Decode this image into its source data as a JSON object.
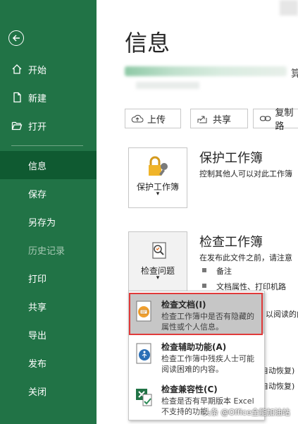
{
  "sidebar": {
    "items": [
      {
        "label": "开始"
      },
      {
        "label": "新建"
      },
      {
        "label": "打开"
      },
      {
        "label": "信息"
      },
      {
        "label": "保存"
      },
      {
        "label": "另存为"
      },
      {
        "label": "历史记录"
      },
      {
        "label": "打印"
      },
      {
        "label": "共享"
      },
      {
        "label": "导出"
      },
      {
        "label": "发布"
      },
      {
        "label": "关闭"
      }
    ]
  },
  "main": {
    "title": "信息",
    "path_end": "算",
    "toolbar": {
      "upload": "上传",
      "share": "共享",
      "copy_path": "复制路"
    },
    "protect": {
      "button_label": "保护工作簿",
      "title": "保护工作簿",
      "desc": "控制其他人可以对此工作簿"
    },
    "inspect": {
      "button_label": "检查问题",
      "title": "检查工作簿",
      "desc": "在发布此文件之前，请注意",
      "bullets": [
        "备注",
        "文档属性、打印机路"
      ],
      "partial_lines": [
        "以阅读的内",
        "自动恢复)",
        "自动恢复)"
      ]
    },
    "dropdown": {
      "items": [
        {
          "title": "检查文档(I)",
          "desc": "检查工作簿中是否有隐藏的属性或个人信息。"
        },
        {
          "title": "检查辅助功能(A)",
          "desc": "检查工作簿中残疾人士可能阅读困难的内容。"
        },
        {
          "title": "检查兼容性(C)",
          "desc": "检查是否有早期版本 Excel 不支持的功能"
        }
      ]
    }
  },
  "watermark": "头条 @Office全能加油站",
  "colors": {
    "sidebar_bg": "#217346",
    "sidebar_active": "#0f5a31",
    "highlight": "#c6c6c6",
    "outline": "#e03a3a"
  }
}
